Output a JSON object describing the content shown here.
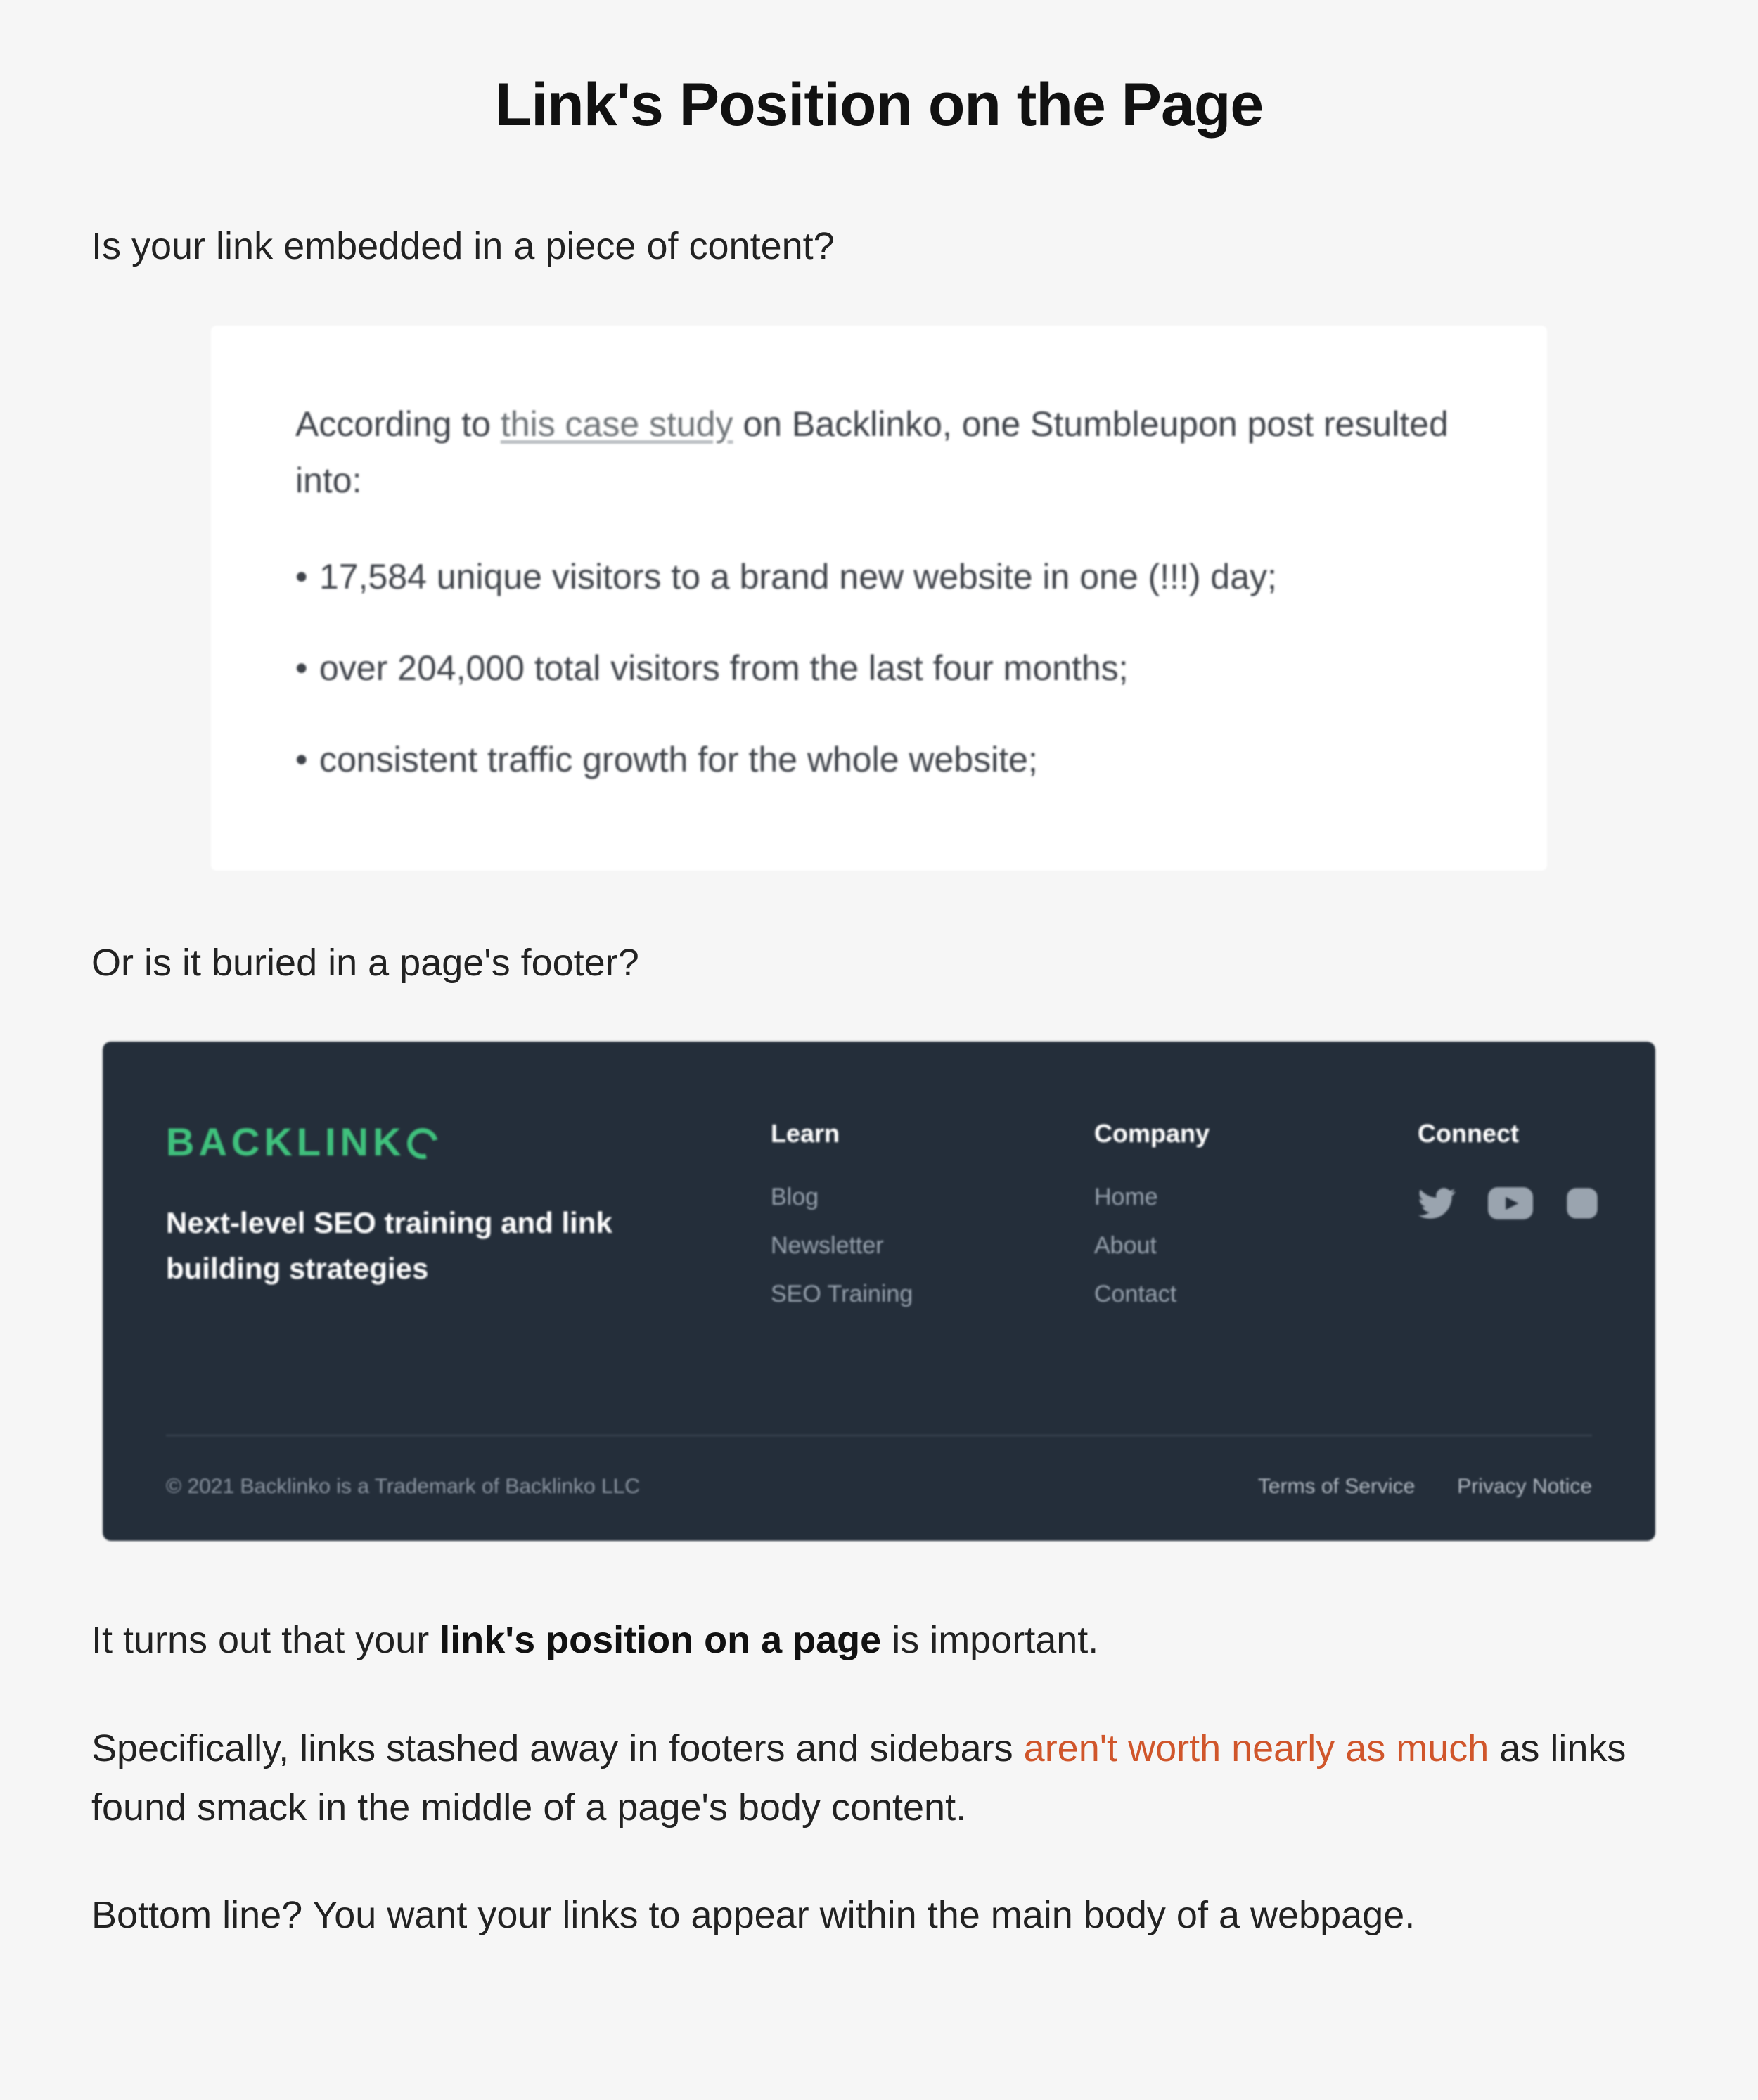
{
  "heading": "Link's Position on the Page",
  "para1": "Is your link embedded in a piece of content?",
  "content_card": {
    "lead_before": "According to ",
    "lead_link": "this case study",
    "lead_after": " on Backlinko, one Stumbleupon post resulted into:",
    "bullets": [
      "17,584 unique visitors to a brand new website in one (!!!) day;",
      "over 204,000 total visitors from the last four months;",
      "consistent traffic growth for the whole website;"
    ]
  },
  "para2": "Or is it buried in a page's footer?",
  "footer_card": {
    "brand_text": "BACKLINK",
    "tagline": "Next-level SEO training and link building strategies",
    "col1": {
      "title": "Learn",
      "items": [
        "Blog",
        "Newsletter",
        "SEO Training"
      ]
    },
    "col2": {
      "title": "Company",
      "items": [
        "Home",
        "About",
        "Contact"
      ]
    },
    "connect_title": "Connect",
    "copyright": "© 2021 Backlinko is a Trademark of Backlinko LLC",
    "tos": "Terms of Service",
    "privacy": "Privacy Notice"
  },
  "para3_before": "It turns out that your ",
  "para3_bold": "link's position on a page",
  "para3_after": " is important.",
  "para4_before": "Specifically, links stashed away in footers and sidebars ",
  "para4_link": "aren't worth nearly as much",
  "para4_after": " as links found smack in the middle of a page's body content.",
  "para5": "Bottom line? You want your links to appear within the main body of a webpage."
}
